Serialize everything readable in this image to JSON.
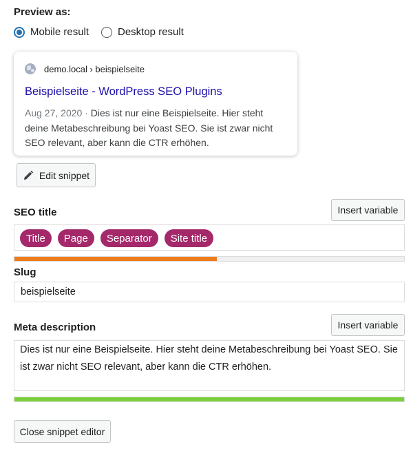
{
  "preview": {
    "label": "Preview as:",
    "options": [
      {
        "label": "Mobile result",
        "selected": true
      },
      {
        "label": "Desktop result",
        "selected": false
      }
    ]
  },
  "snippet": {
    "site_icon": "globe-icon",
    "breadcrumb": "demo.local › beispielseite",
    "title": "Beispielseite - WordPress SEO Plugins",
    "date": "Aug 27, 2020",
    "separator": "·",
    "description": "Dies ist nur eine Beispielseite. Hier steht deine Metabeschreibung bei Yoast SEO. Sie ist zwar nicht SEO relevant, aber kann die CTR erhöhen."
  },
  "edit_snippet": {
    "label": "Edit snippet",
    "icon": "pencil-icon"
  },
  "seo_title": {
    "label": "SEO title",
    "insert_variable": "Insert variable",
    "variables": [
      "Title",
      "Page",
      "Separator",
      "Site title"
    ],
    "progress": 0.52,
    "progress_color": "#ee7c1b"
  },
  "slug": {
    "label": "Slug",
    "value": "beispielseite"
  },
  "meta_description": {
    "label": "Meta description",
    "insert_variable": "Insert variable",
    "value": "Dies ist nur eine Beispielseite.  Hier steht deine Metabeschreibung bei Yoast SEO. Sie ist zwar nicht SEO relevant, aber kann die CTR erhöhen.",
    "progress": 1.0,
    "progress_color": "#7ad03a"
  },
  "close_editor": {
    "label": "Close snippet editor"
  },
  "colors": {
    "accent": "#2271b1",
    "pill": "#a4286a",
    "link": "#1a0dab"
  }
}
